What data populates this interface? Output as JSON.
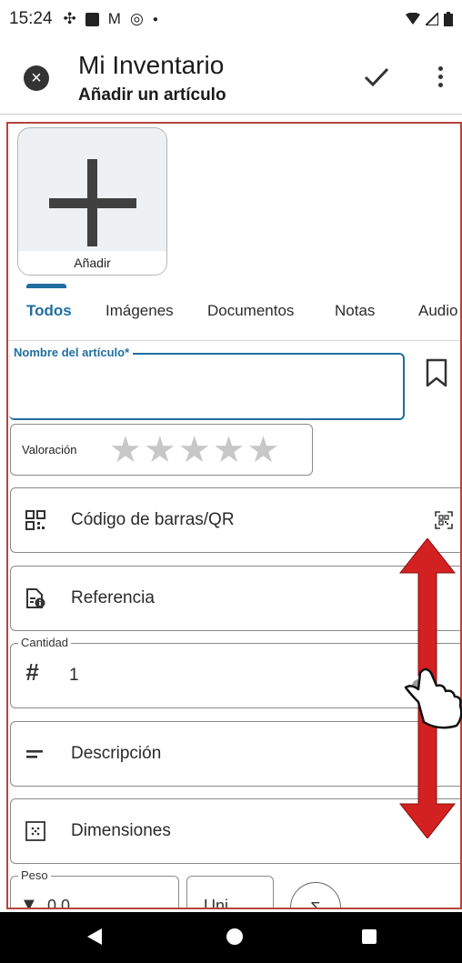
{
  "status_bar": {
    "time": "15:24",
    "icons": [
      "pinwheel-icon",
      "a-box-icon",
      "gmail-icon",
      "at-icon",
      "dot-icon",
      "wifi-icon",
      "signal-icon",
      "battery-icon"
    ]
  },
  "app_bar": {
    "title": "Mi Inventario",
    "subtitle": "Añadir un artículo",
    "close_icon": "close-circle-icon",
    "confirm_icon": "check-icon",
    "menu_icon": "more-vert-icon"
  },
  "media": {
    "add_label": "Añadir"
  },
  "tabs": [
    {
      "label": "Todos",
      "active": true
    },
    {
      "label": "Imágenes",
      "active": false
    },
    {
      "label": "Documentos",
      "active": false
    },
    {
      "label": "Notas",
      "active": false
    },
    {
      "label": "Audio",
      "active": false
    }
  ],
  "form": {
    "name_legend": "Nombre del artículo*",
    "name_value": "",
    "rating_label": "Valoración",
    "rating_stars": 5,
    "rating_value": 0,
    "barcode_label": "Código de barras/QR",
    "reference_label": "Referencia",
    "quantity_legend": "Cantidad",
    "quantity_value": "1",
    "description_label": "Descripción",
    "dimensions_label": "Dimensiones",
    "weight_legend": "Peso",
    "weight_value": "0.0",
    "unit_value": "Uni...",
    "sum_label": "Σ"
  },
  "colors": {
    "accent": "#1e6fa0",
    "frame": "#b7433d",
    "gesture_arrow": "#d32020"
  }
}
